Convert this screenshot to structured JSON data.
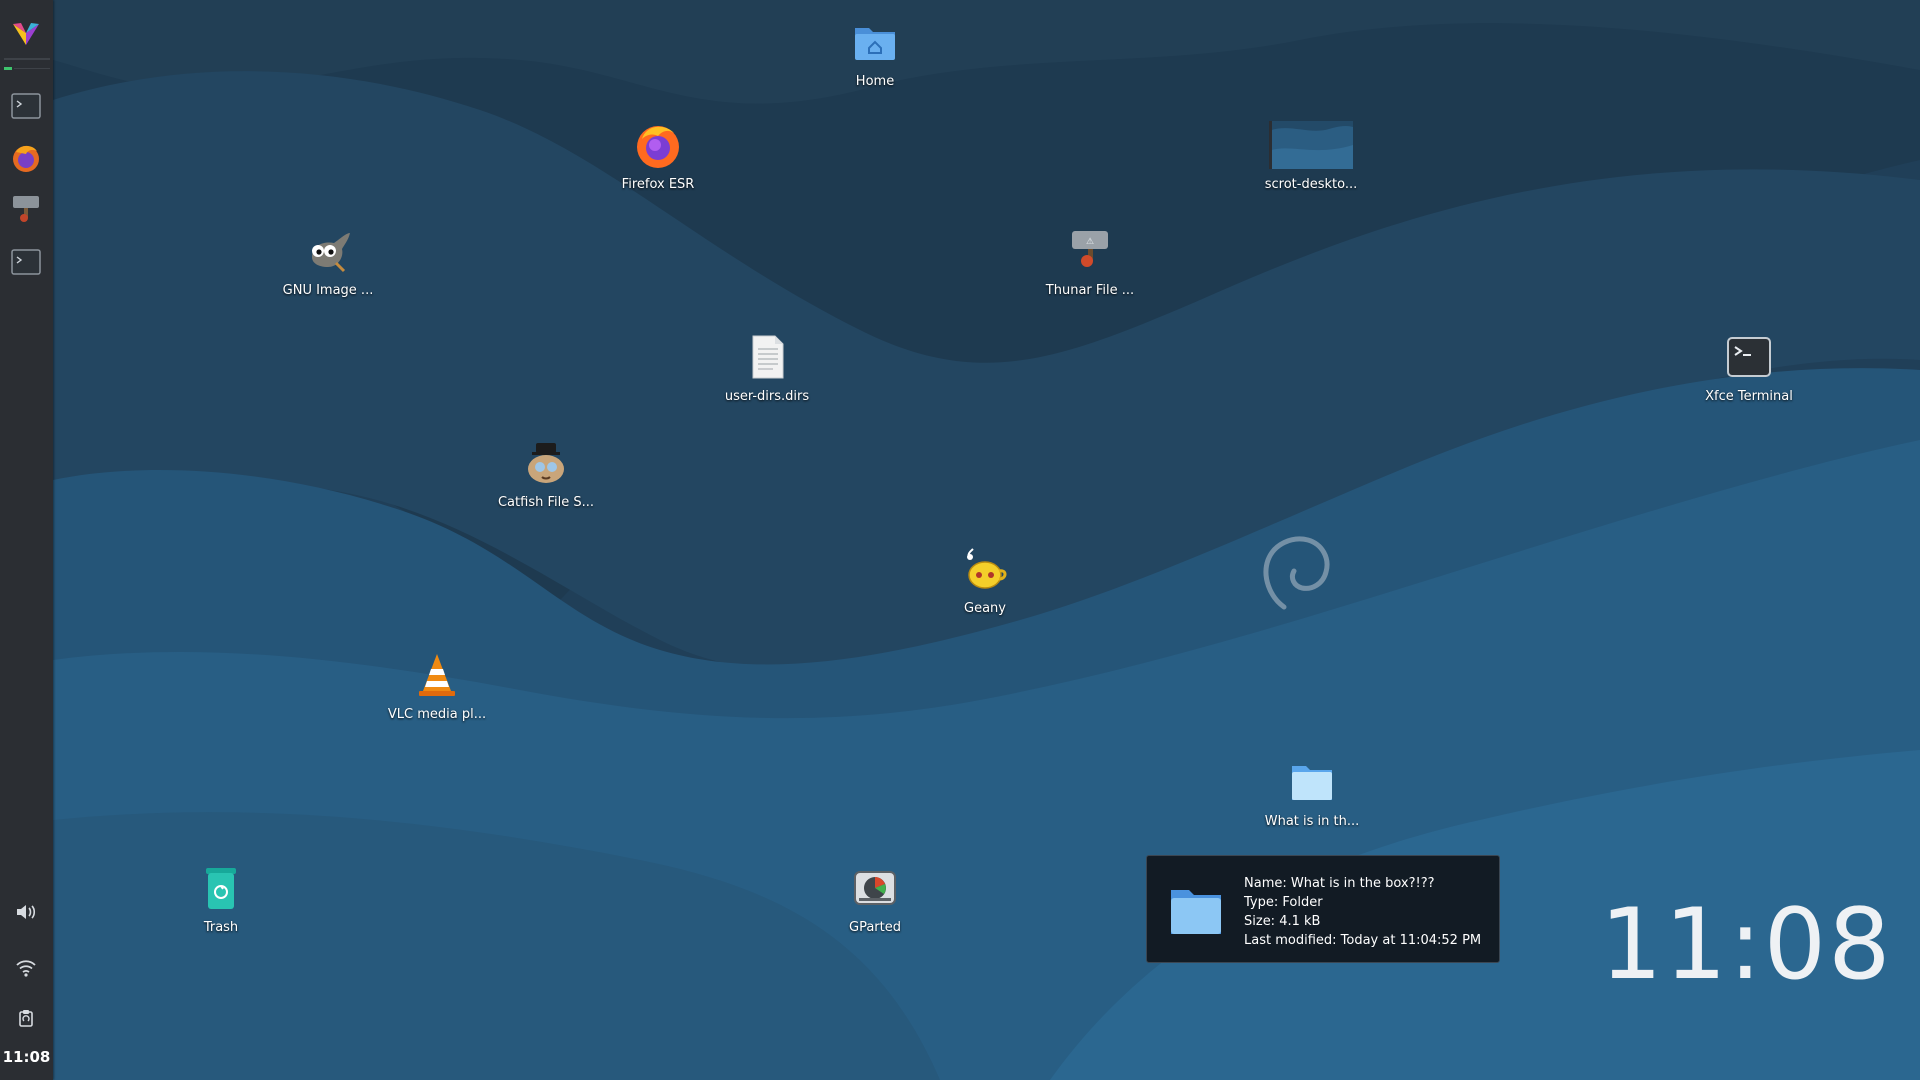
{
  "panel": {
    "items": [
      {
        "name": "whisker-menu",
        "icon": "xfce-menu-icon"
      },
      {
        "name": "terminal",
        "icon": "terminal-icon"
      },
      {
        "name": "firefox",
        "icon": "firefox-icon"
      },
      {
        "name": "thunar",
        "icon": "thunar-file-manager-icon"
      },
      {
        "name": "terminal-2",
        "icon": "terminal-icon"
      }
    ],
    "tray": [
      {
        "name": "volume",
        "icon": "speaker-icon"
      },
      {
        "name": "network",
        "icon": "wifi-icon"
      },
      {
        "name": "clipboard",
        "icon": "clipboard-icon"
      }
    ],
    "clock": "11:08"
  },
  "desktop": {
    "icons": {
      "home": {
        "label": "Home",
        "icon": "home-folder-icon"
      },
      "firefox": {
        "label": "Firefox ESR",
        "icon": "firefox-icon"
      },
      "scrot": {
        "label": "scrot-deskto...",
        "icon": "image-thumbnail-icon"
      },
      "gimp": {
        "label": "GNU Image ...",
        "icon": "gimp-icon"
      },
      "thunar": {
        "label": "Thunar File ...",
        "icon": "thunar-file-manager-icon"
      },
      "userdirs": {
        "label": "user-dirs.dirs",
        "icon": "text-file-icon"
      },
      "terminal": {
        "label": "Xfce Terminal",
        "icon": "terminal-icon"
      },
      "catfish": {
        "label": "Catfish File S...",
        "icon": "catfish-icon"
      },
      "geany": {
        "label": "Geany",
        "icon": "geany-icon"
      },
      "vlc": {
        "label": "VLC media pl...",
        "icon": "vlc-icon"
      },
      "box": {
        "label": "What is in th...",
        "icon": "folder-icon"
      },
      "trash": {
        "label": "Trash",
        "icon": "trash-icon"
      },
      "gparted": {
        "label": "GParted",
        "icon": "gparted-icon"
      }
    }
  },
  "tooltip": {
    "name": "Name: What is in the box?!??",
    "type": "Type: Folder",
    "size": "Size: 4.1 kB",
    "modified": "Last modified: Today at 11:04:52 PM"
  },
  "conky": {
    "time": "11:08"
  },
  "colors": {
    "wallpaper_dark": "#1f3c54",
    "wallpaper_mid": "#224a68",
    "wallpaper_light": "#2a5f86",
    "panel": "#2b2e33",
    "accent_green": "#3ec46d"
  }
}
